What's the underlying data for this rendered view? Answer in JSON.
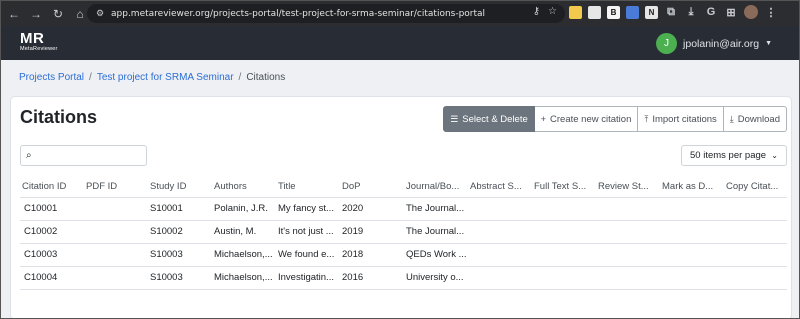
{
  "browser": {
    "url": "app.metareviewer.org/projects-portal/test-project-for-srma-seminar/citations-portal"
  },
  "brand": {
    "title": "MR",
    "subtitle": "MetaReviewer"
  },
  "user": {
    "initial": "J",
    "email": "jpolanin@air.org"
  },
  "breadcrumb": {
    "items": [
      "Projects Portal",
      "Test project for SRMA Seminar"
    ],
    "current": "Citations",
    "separator": "/"
  },
  "page": {
    "title": "Citations"
  },
  "toolbar": {
    "select_delete": "Select & Delete",
    "create": "Create new citation",
    "import": "Import citations",
    "download": "Download"
  },
  "search": {
    "placeholder": "",
    "value": ""
  },
  "pagination": {
    "per_page": "50 items per page"
  },
  "table": {
    "columns": [
      "Citation ID",
      "PDF ID",
      "Study ID",
      "Authors",
      "Title",
      "DoP",
      "Journal/Bo...",
      "Abstract S...",
      "Full Text S...",
      "Review St...",
      "Mark as D...",
      "Copy Citat..."
    ],
    "rows": [
      [
        "C10001",
        "",
        "S10001",
        "Polanin, J.R.",
        "My fancy st...",
        "2020",
        "The Journal...",
        "",
        "",
        "",
        "",
        ""
      ],
      [
        "C10002",
        "",
        "S10002",
        "Austin, M.",
        "It's not just ...",
        "2019",
        "The Journal...",
        "",
        "",
        "",
        "",
        ""
      ],
      [
        "C10003",
        "",
        "S10003",
        "Michaelson,...",
        "We found e...",
        "2018",
        "QEDs Work ...",
        "",
        "",
        "",
        "",
        ""
      ],
      [
        "C10004",
        "",
        "S10003",
        "Michaelson,...",
        "Investigatin...",
        "2016",
        "University o...",
        "",
        "",
        "",
        "",
        ""
      ]
    ]
  },
  "colors": {
    "header_bg": "#282c34",
    "primary_button": "#6c757d",
    "link": "#2c6ed5",
    "avatar": "#4caf50"
  }
}
